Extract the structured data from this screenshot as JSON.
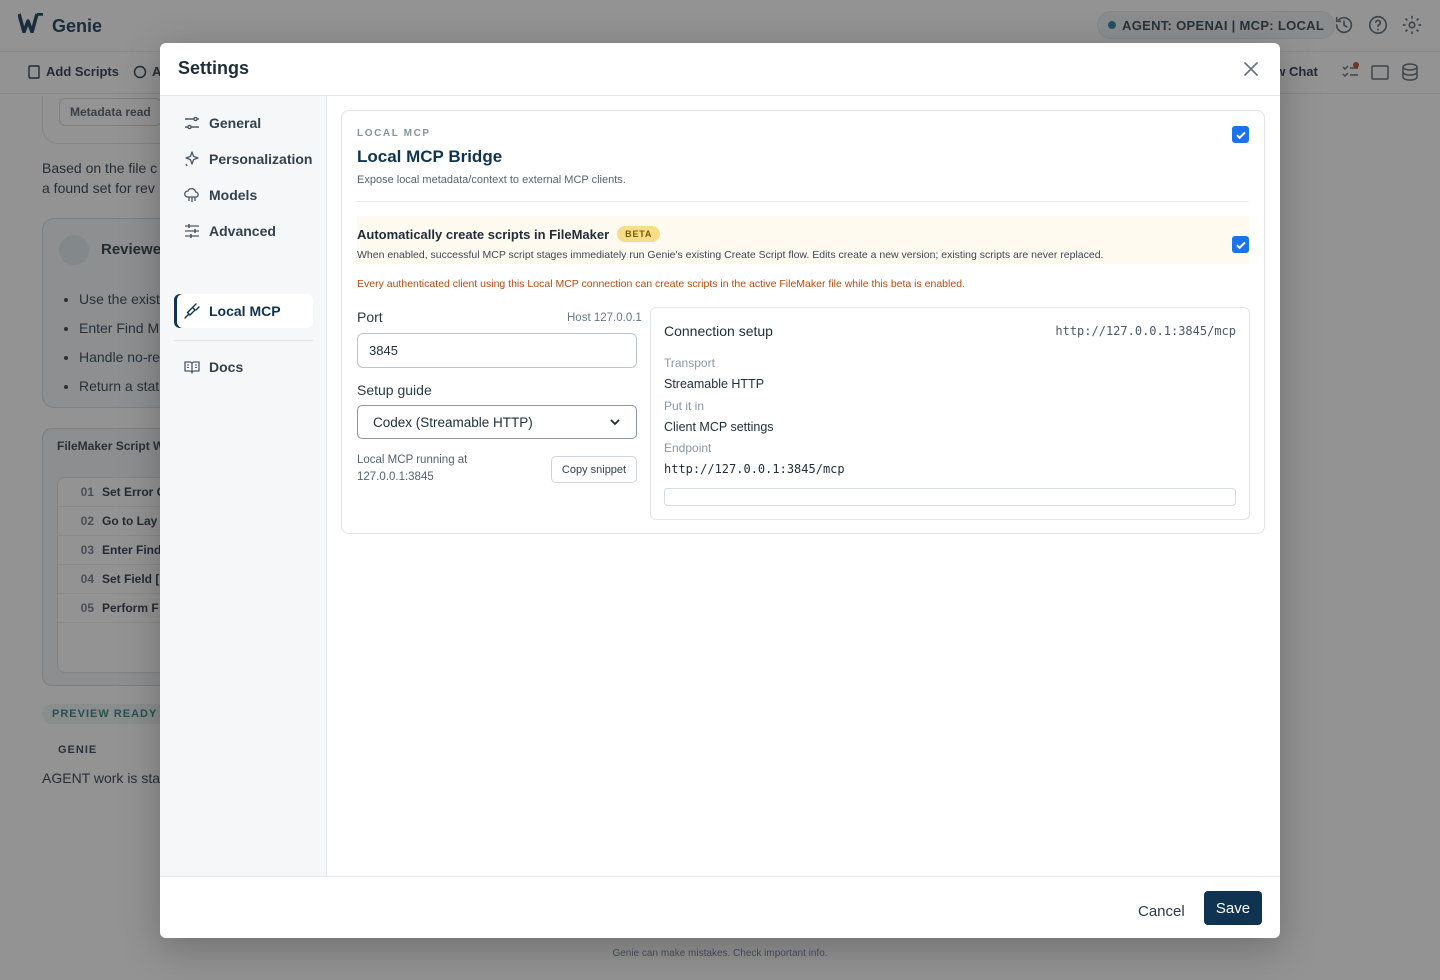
{
  "app": {
    "brand": "Genie",
    "agent_status": "AGENT: OPENAI | MCP: LOCAL",
    "toolbar": {
      "add_scripts": "Add Scripts",
      "clipped_label": "A",
      "new_chat": "ew Chat"
    },
    "background": {
      "metadata_chip": "Metadata read",
      "found_text_1": "Based on the file c",
      "found_text_2": "a found set for rev",
      "review_title": "Reviewe",
      "review_items": [
        "Use the exist",
        "Enter Find M",
        "Handle no-re",
        "Return a stat"
      ],
      "script_header": "FileMaker Script Wo",
      "script_rows": [
        {
          "num": "01",
          "text": "Set Error C"
        },
        {
          "num": "02",
          "text": "Go to Lay"
        },
        {
          "num": "03",
          "text": "Enter Find"
        },
        {
          "num": "04",
          "text": "Set Field ["
        },
        {
          "num": "05",
          "text": "Perform F"
        }
      ],
      "preview_ready": "PREVIEW READY",
      "genie_label": "GENIE",
      "agent_work": "AGENT work is sta",
      "footer_note": "Genie can make mistakes. Check important info."
    }
  },
  "modal": {
    "title": "Settings",
    "nav": [
      {
        "label": "General",
        "icon": "sliders-icon"
      },
      {
        "label": "Personalization",
        "icon": "sparkle-icon"
      },
      {
        "label": "Models",
        "icon": "cloud-icon"
      },
      {
        "label": "Advanced",
        "icon": "tune-icon"
      },
      {
        "label": "Local MCP",
        "icon": "plug-icon",
        "active": true
      },
      {
        "label": "Docs",
        "icon": "book-icon"
      }
    ],
    "local_mcp": {
      "eyebrow": "LOCAL MCP",
      "title": "Local MCP Bridge",
      "description": "Expose local metadata/context to external MCP clients.",
      "enabled": true,
      "auto_create_title": "Automatically create scripts in FileMaker",
      "beta_badge": "BETA",
      "auto_create_desc": "When enabled, successful MCP script stages immediately run Genie's existing Create Script flow. Edits create a new version; existing scripts are never replaced.",
      "auto_create_enabled": true,
      "warning": "Every authenticated client using this Local MCP connection can create scripts in the active FileMaker file while this beta is enabled.",
      "port_label": "Port",
      "host_label": "Host 127.0.0.1",
      "port_value": "3845",
      "setup_guide_label": "Setup guide",
      "setup_guide_value": "Codex (Streamable HTTP)",
      "running_text": "Local MCP running at 127.0.0.1:3845",
      "copy_snippet": "Copy snippet",
      "connection": {
        "title": "Connection setup",
        "url": "http://127.0.0.1:3845/mcp",
        "transport_label": "Transport",
        "transport_value": "Streamable HTTP",
        "put_label": "Put it in",
        "put_value": "Client MCP settings",
        "endpoint_label": "Endpoint",
        "endpoint_value": "http://127.0.0.1:3845/mcp"
      }
    },
    "footer": {
      "cancel": "Cancel",
      "save": "Save"
    }
  },
  "colors": {
    "brand": "#0f3350",
    "checkbox": "#1a73e8",
    "warning": "#b44a0d",
    "beta_badge": "#f6dd8a"
  }
}
